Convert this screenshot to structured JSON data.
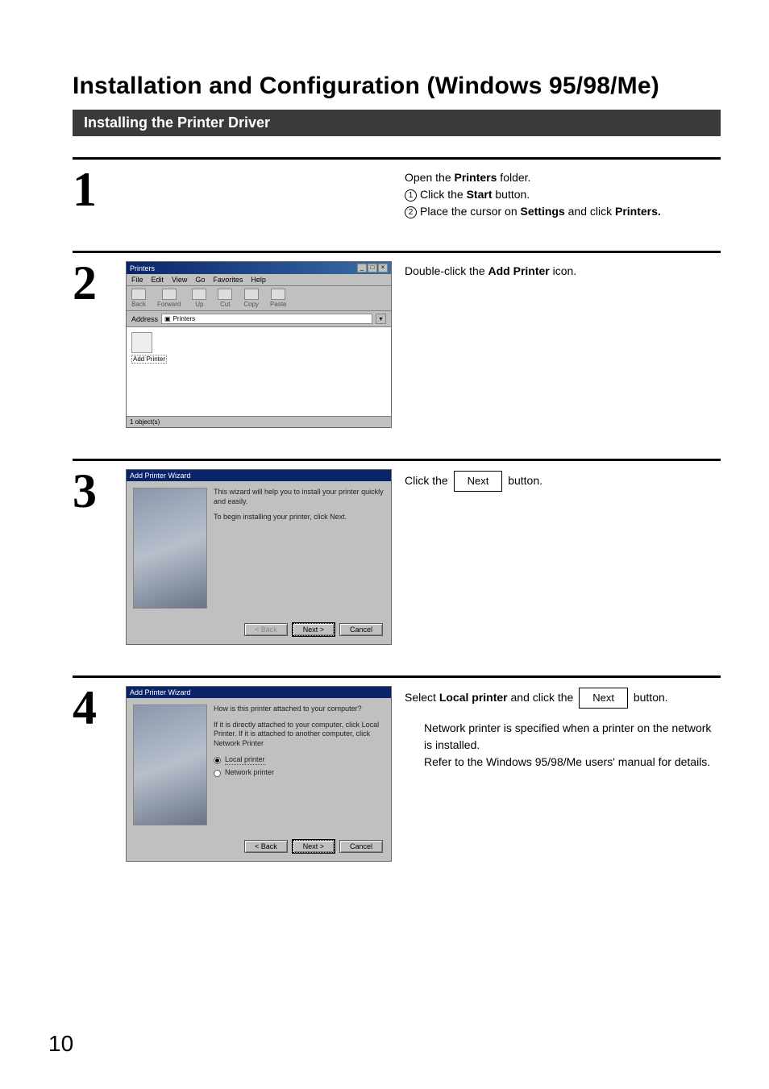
{
  "page_number": "10",
  "title": "Installation and Configuration (Windows 95/98/Me)",
  "section": "Installing the Printer Driver",
  "steps": {
    "s1": {
      "num": "1",
      "line1_a": "Open the ",
      "line1_b": "Printers",
      "line1_c": " folder.",
      "c1": "1",
      "sub1_a": "Click the ",
      "sub1_b": "Start",
      "sub1_c": " button.",
      "c2": "2",
      "sub2_a": "Place the cursor on ",
      "sub2_b": "Settings",
      "sub2_c": " and click ",
      "sub2_d": "Printers."
    },
    "s2": {
      "num": "2",
      "right_a": "Double-click  the  ",
      "right_b": "Add  Printer",
      "right_c": "  icon.",
      "win": {
        "title": "Printers",
        "menus": {
          "file": "File",
          "edit": "Edit",
          "view": "View",
          "go": "Go",
          "fav": "Favorites",
          "help": "Help"
        },
        "tb": {
          "back": "Back",
          "forward": "Forward",
          "up": "Up",
          "cut": "Cut",
          "copy": "Copy",
          "paste": "Paste"
        },
        "addr_label": "Address",
        "addr_value": "Printers",
        "icon_label": "Add Printer",
        "status": "1 object(s)"
      }
    },
    "s3": {
      "num": "3",
      "right_a": "Click the ",
      "right_btn": "Next",
      "right_b": " button.",
      "wiz": {
        "title": "Add Printer Wizard",
        "p1": "This wizard will help you to install your printer quickly and easily.",
        "p2": "To begin installing your printer, click Next.",
        "back": "< Back",
        "next": "Next >",
        "cancel": "Cancel"
      }
    },
    "s4": {
      "num": "4",
      "right_a": "Select ",
      "right_b": "Local printer",
      "right_c": " and click the ",
      "right_btn": "Next",
      "right_d": " button.",
      "note1": "Network printer is specified when a printer on the network is installed.",
      "note2": "Refer to the Windows 95/98/Me users' manual for details.",
      "wiz": {
        "title": "Add Printer Wizard",
        "q": "How is this printer attached to your computer?",
        "expl": "If it is directly attached to your computer, click Local Printer. If it is attached to another computer, click Network Printer",
        "opt1": "Local printer",
        "opt2": "Network printer",
        "back": "< Back",
        "next": "Next >",
        "cancel": "Cancel"
      }
    }
  }
}
